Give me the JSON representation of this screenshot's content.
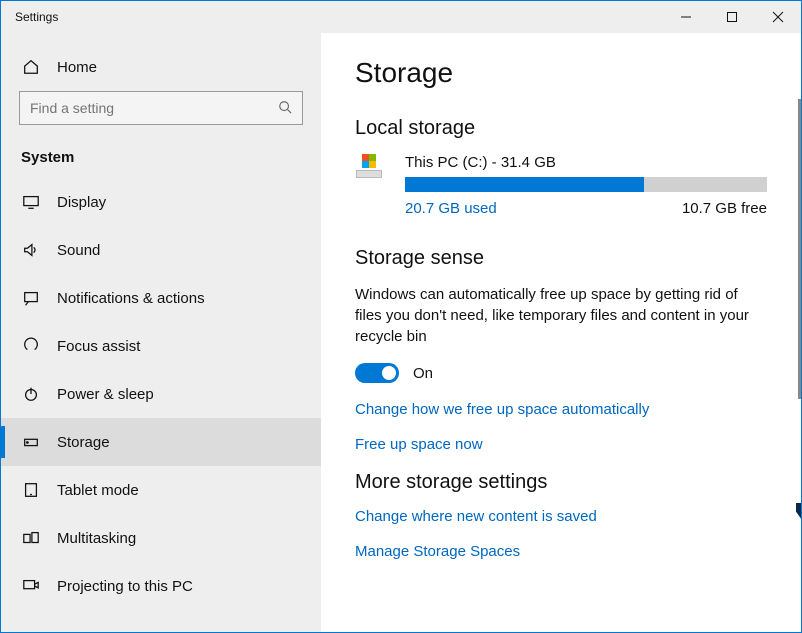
{
  "window": {
    "title": "Settings"
  },
  "sidebar": {
    "home": "Home",
    "search_placeholder": "Find a setting",
    "section": "System",
    "items": [
      {
        "label": "Display"
      },
      {
        "label": "Sound"
      },
      {
        "label": "Notifications & actions"
      },
      {
        "label": "Focus assist"
      },
      {
        "label": "Power & sleep"
      },
      {
        "label": "Storage"
      },
      {
        "label": "Tablet mode"
      },
      {
        "label": "Multitasking"
      },
      {
        "label": "Projecting to this PC"
      }
    ]
  },
  "main": {
    "title": "Storage",
    "local_storage_heading": "Local storage",
    "drive": {
      "name": "This PC (C:) - 31.4 GB",
      "used_label": "20.7 GB used",
      "free_label": "10.7 GB free",
      "used_pct": 66
    },
    "sense_heading": "Storage sense",
    "sense_desc": "Windows can automatically free up space by getting rid of files you don't need, like temporary files and content in your recycle bin",
    "toggle_state": "On",
    "link_change": "Change how we free up space automatically",
    "link_freeup": "Free up space now",
    "more_heading": "More storage settings",
    "link_save_loc": "Change where new content is saved",
    "link_spaces": "Manage Storage Spaces"
  }
}
